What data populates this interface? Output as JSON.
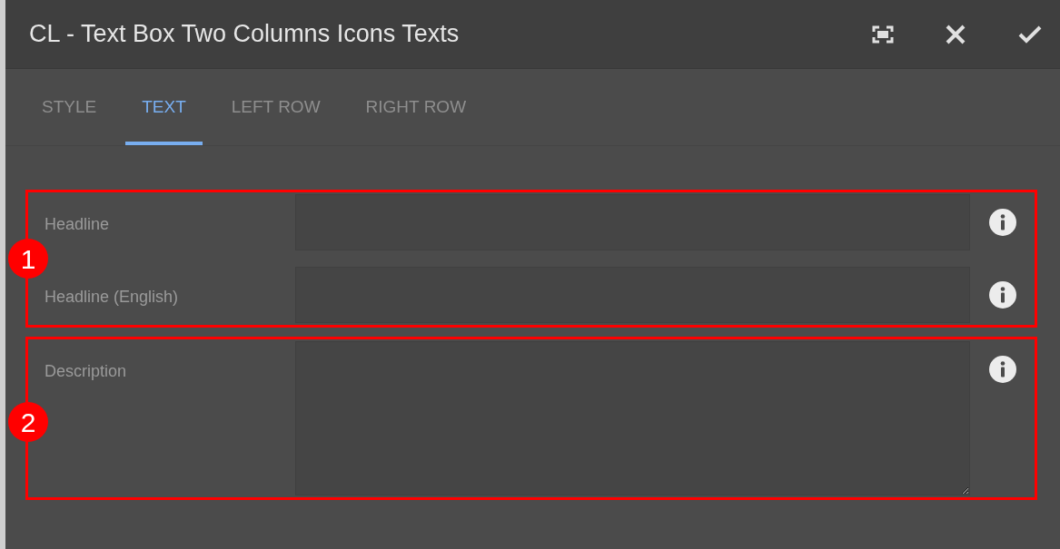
{
  "dialog": {
    "title": "CL - Text Box Two Columns Icons Texts"
  },
  "tabs": [
    {
      "label": "STYLE",
      "selected": false
    },
    {
      "label": "TEXT",
      "selected": true
    },
    {
      "label": "LEFT ROW",
      "selected": false
    },
    {
      "label": "RIGHT ROW",
      "selected": false
    }
  ],
  "groups": [
    {
      "callout": "1",
      "fields": [
        {
          "label": "Headline",
          "kind": "text"
        },
        {
          "label": "Headline (English)",
          "kind": "text"
        }
      ]
    },
    {
      "callout": "2",
      "fields": [
        {
          "label": "Description",
          "kind": "textarea"
        }
      ]
    }
  ]
}
